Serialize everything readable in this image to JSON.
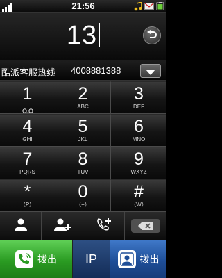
{
  "status_bar": {
    "time": "21:56",
    "icons": [
      "signal-icon",
      "music-note-icon",
      "message-icon",
      "battery-icon"
    ]
  },
  "dialer": {
    "number": "13",
    "backspace_icon": "back-arrow-icon"
  },
  "match": {
    "name": "酷派客服热线",
    "number": "4008881388",
    "dropdown_icon": "triangle-down-icon"
  },
  "keypad": [
    {
      "digit": "1",
      "sub": ""
    },
    {
      "digit": "2",
      "sub": "ABC"
    },
    {
      "digit": "3",
      "sub": "DEF"
    },
    {
      "digit": "4",
      "sub": "GHI"
    },
    {
      "digit": "5",
      "sub": "JKL"
    },
    {
      "digit": "6",
      "sub": "MNO"
    },
    {
      "digit": "7",
      "sub": "PQRS"
    },
    {
      "digit": "8",
      "sub": "TUV"
    },
    {
      "digit": "9",
      "sub": "WXYZ"
    },
    {
      "digit": "*",
      "sub": "（P）"
    },
    {
      "digit": "0",
      "sub": "（+）"
    },
    {
      "digit": "#",
      "sub": "（W）"
    }
  ],
  "actions": [
    "contacts-icon",
    "add-contact-icon",
    "add-call-icon",
    "delete-icon"
  ],
  "call_buttons": {
    "dial_label": "拨出",
    "ip_label": "IP",
    "video_dial_label": "拨出"
  },
  "colors": {
    "dial_green": "#2a9b22",
    "dial_blue": "#1e4e98",
    "ip_blue": "#132c57"
  }
}
